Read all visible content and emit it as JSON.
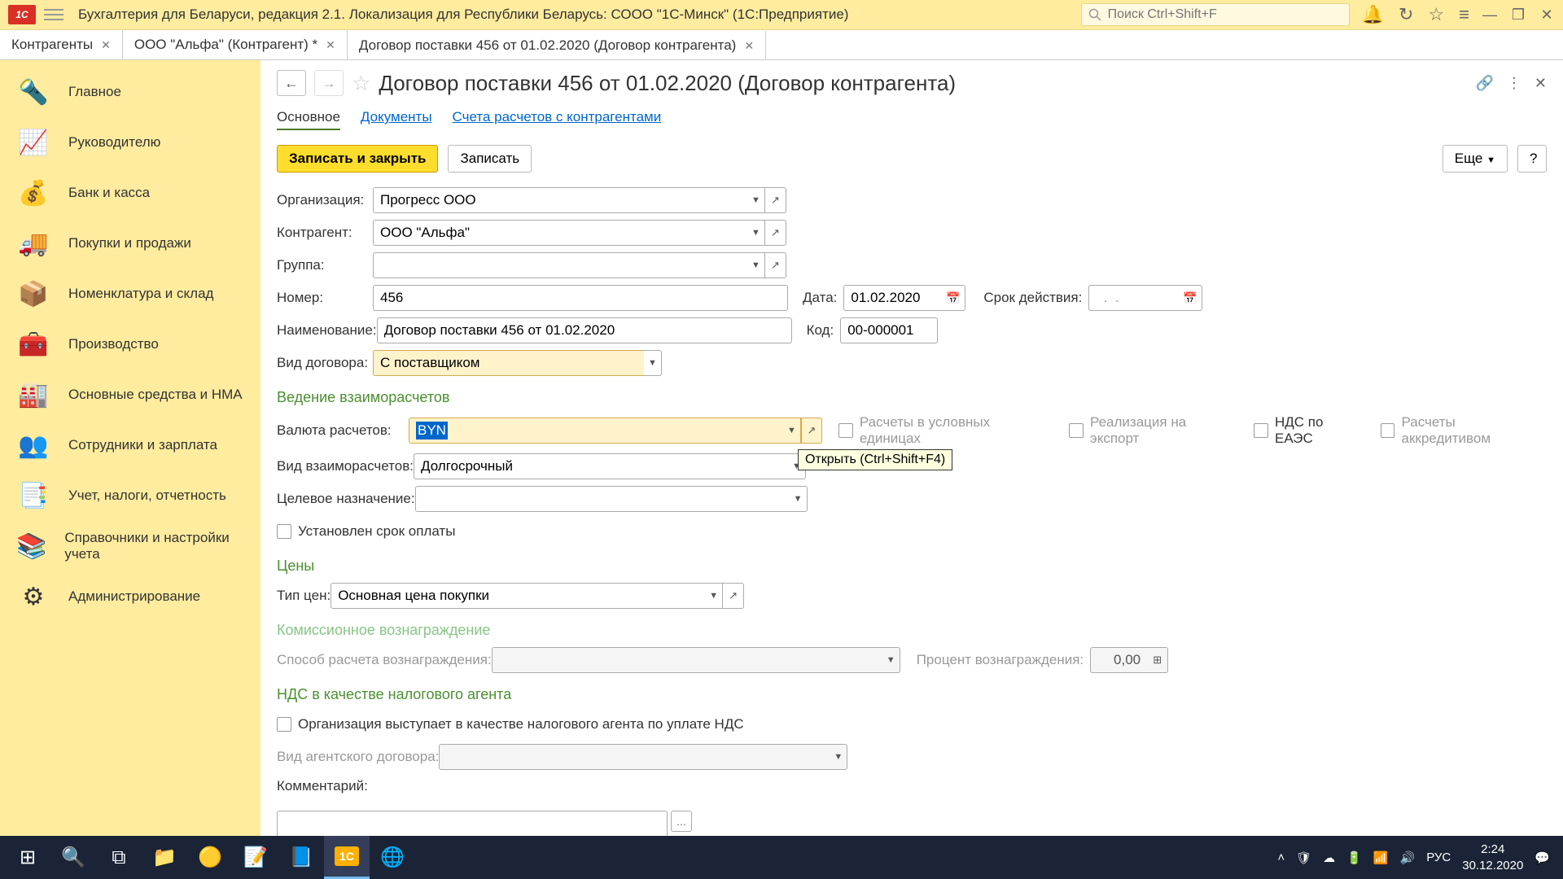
{
  "titlebar": {
    "app_title": "Бухгалтерия для Беларуси, редакция 2.1. Локализация для Республики Беларусь: СООО \"1С-Минск\"  (1С:Предприятие)",
    "search_placeholder": "Поиск Ctrl+Shift+F"
  },
  "tabs": [
    {
      "label": "Контрагенты",
      "closable": true
    },
    {
      "label": "ООО \"Альфа\" (Контрагент) *",
      "closable": true
    },
    {
      "label": "Договор поставки 456 от 01.02.2020 (Договор контрагента)",
      "closable": true,
      "active": true
    }
  ],
  "sidebar": [
    {
      "icon": "🔦",
      "label": "Главное"
    },
    {
      "icon": "📈",
      "label": "Руководителю"
    },
    {
      "icon": "💰",
      "label": "Банк и касса"
    },
    {
      "icon": "🚚",
      "label": "Покупки и продажи"
    },
    {
      "icon": "📦",
      "label": "Номенклатура и склад"
    },
    {
      "icon": "🧰",
      "label": "Производство"
    },
    {
      "icon": "🏭",
      "label": "Основные средства и НМА"
    },
    {
      "icon": "👥",
      "label": "Сотрудники и зарплата"
    },
    {
      "icon": "📑",
      "label": "Учет, налоги, отчетность"
    },
    {
      "icon": "📚",
      "label": "Справочники и настройки учета"
    },
    {
      "icon": "⚙",
      "label": "Администрирование"
    }
  ],
  "page": {
    "title": "Договор поставки 456 от 01.02.2020 (Договор контрагента)",
    "subtabs": {
      "main": "Основное",
      "docs": "Документы",
      "accounts": "Счета расчетов с контрагентами"
    },
    "buttons": {
      "save_close": "Записать и закрыть",
      "save": "Записать",
      "more": "Еще",
      "help": "?"
    },
    "labels": {
      "org": "Организация:",
      "contr": "Контрагент:",
      "group": "Группа:",
      "number": "Номер:",
      "date": "Дата:",
      "validity": "Срок действия:",
      "name": "Наименование:",
      "code": "Код:",
      "contract_type": "Вид договора:",
      "section_settlement": "Ведение взаиморасчетов",
      "currency": "Валюта расчетов:",
      "settlement_type": "Вид взаиморасчетов:",
      "purpose": "Целевое назначение:",
      "chk_conditional": "Расчеты в условных единицах",
      "chk_export": "Реализация на экспорт",
      "chk_eaes": "НДС по ЕАЭС",
      "chk_letter": "Расчеты аккредитивом",
      "chk_payment_term": "Установлен срок оплаты",
      "section_prices": "Цены",
      "price_type": "Тип цен:",
      "section_commission": "Комиссионное вознаграждение",
      "reward_method": "Способ расчета вознаграждения:",
      "reward_percent": "Процент вознаграждения:",
      "section_vat": "НДС в качестве налогового агента",
      "chk_vat_agent": "Организация выступает в качестве налогового агента по уплате НДС",
      "agent_type": "Вид агентского договора:",
      "comment": "Комментарий:"
    },
    "values": {
      "org": "Прогресс ООО",
      "contr": "ООО \"Альфа\"",
      "group": "",
      "number": "456",
      "date": "01.02.2020",
      "validity": "  .  .    ",
      "name": "Договор поставки 456 от 01.02.2020",
      "code": "00-000001",
      "contract_type": "С поставщиком",
      "currency": "BYN",
      "settlement_type": "Долгосрочный",
      "purpose": "",
      "price_type": "Основная цена покупки",
      "reward_percent": "0,00",
      "comment": ""
    },
    "tooltip": "Открыть (Ctrl+Shift+F4)"
  },
  "taskbar": {
    "lang": "РУС",
    "time": "2:24",
    "date": "30.12.2020"
  }
}
